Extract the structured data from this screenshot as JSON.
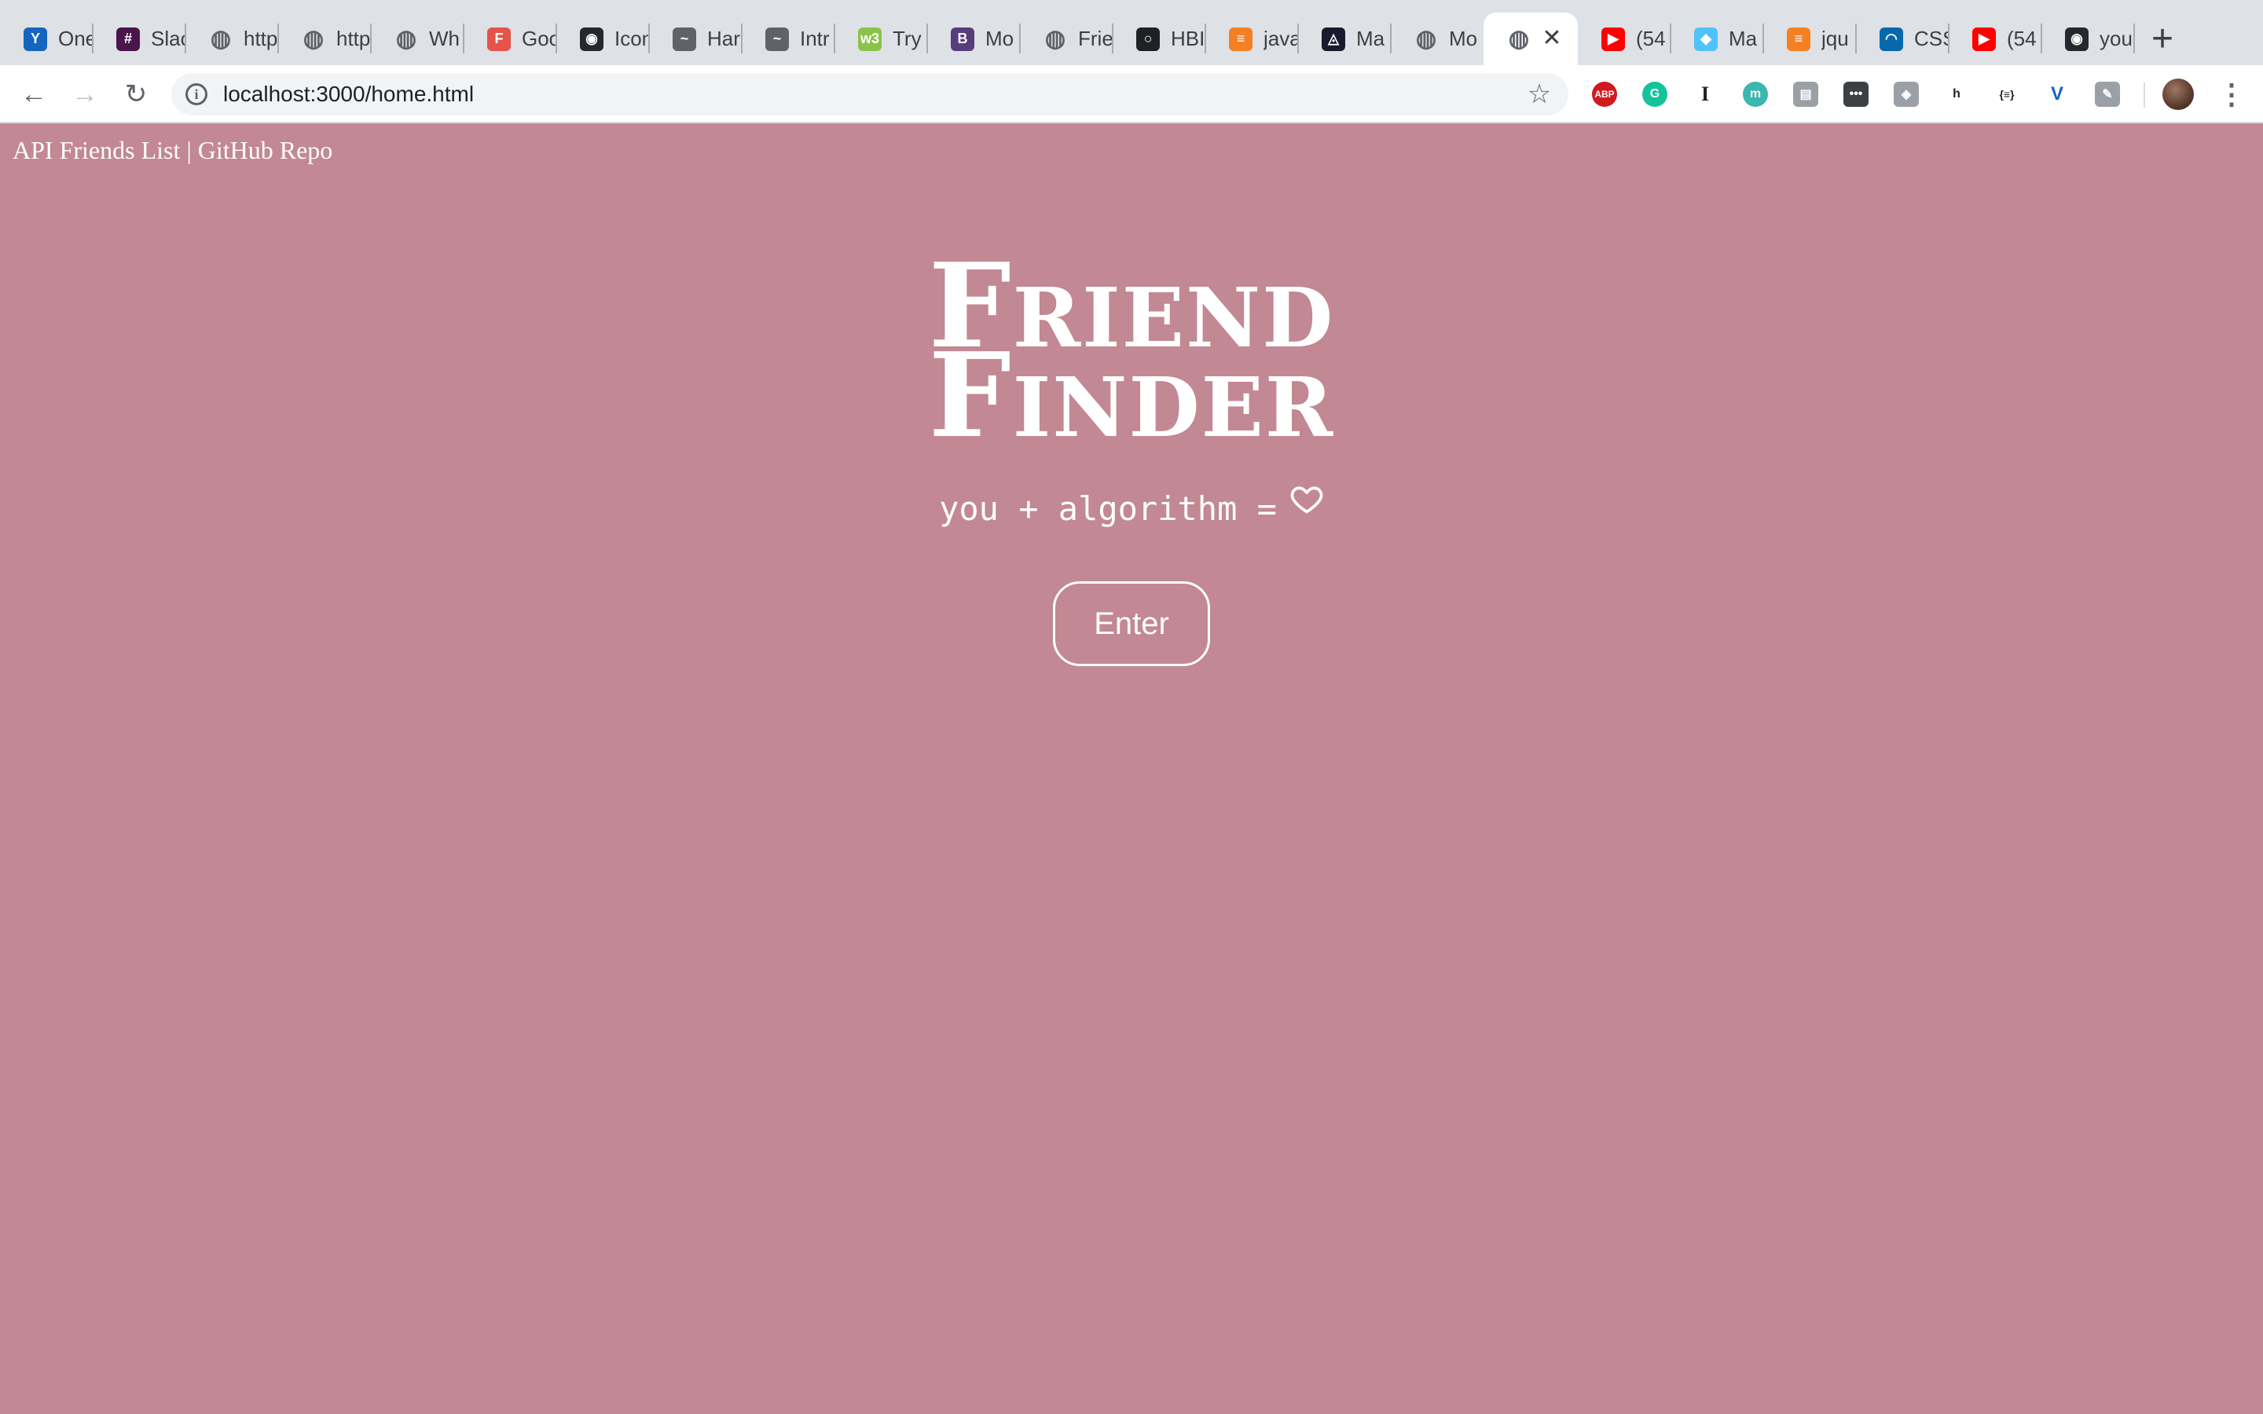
{
  "browser": {
    "tabs": [
      {
        "title": "One",
        "favicon": "vee-icon",
        "color": "#1565c0"
      },
      {
        "title": "Slac",
        "favicon": "slack-icon",
        "color": "#4a154b"
      },
      {
        "title": "http",
        "favicon": "globe-icon",
        "color": "#5f6368"
      },
      {
        "title": "http",
        "favicon": "globe-icon",
        "color": "#5f6368"
      },
      {
        "title": "Wh",
        "favicon": "globe-icon",
        "color": "#5f6368"
      },
      {
        "title": "Goo",
        "favicon": "f-icon",
        "color": "#e5534b"
      },
      {
        "title": "Icon",
        "favicon": "github-octo-icon",
        "color": "#24292e"
      },
      {
        "title": "Har",
        "favicon": "mustache-icon",
        "color": "#5f6368"
      },
      {
        "title": "Intr",
        "favicon": "mustache-icon",
        "color": "#5f6368"
      },
      {
        "title": "Try",
        "favicon": "w3schools-icon",
        "color": "#8bc34a"
      },
      {
        "title": "Mo",
        "favicon": "bootstrap-icon",
        "color": "#563d7c"
      },
      {
        "title": "Frie",
        "favicon": "globe-icon",
        "color": "#5f6368"
      },
      {
        "title": "HBI",
        "favicon": "ring-icon",
        "color": "#202124"
      },
      {
        "title": "java",
        "favicon": "stackoverflow-icon",
        "color": "#f48024"
      },
      {
        "title": "Ma",
        "favicon": "spotlight-icon",
        "color": "#1a1a2e"
      },
      {
        "title": "Mo",
        "favicon": "globe-icon",
        "color": "#5f6368"
      },
      {
        "title": "",
        "favicon": "globe-icon",
        "color": "#5f6368",
        "active": true
      },
      {
        "title": "(54",
        "favicon": "youtube-icon",
        "color": "#ff0000"
      },
      {
        "title": "Ma",
        "favicon": "cap-icon",
        "color": "#4fc3f7"
      },
      {
        "title": "jqu",
        "favicon": "stackoverflow-icon",
        "color": "#f48024"
      },
      {
        "title": "CSS",
        "favicon": "jquery-icon",
        "color": "#0769ad"
      },
      {
        "title": "(54",
        "favicon": "youtube-icon",
        "color": "#ff0000"
      },
      {
        "title": "you",
        "favicon": "github-icon",
        "color": "#24292e"
      }
    ],
    "close_glyph": "✕",
    "new_tab_glyph": "+",
    "back_glyph": "←",
    "forward_glyph": "→",
    "reload_glyph": "↻",
    "info_glyph": "i",
    "star_glyph": "☆",
    "menu_glyph": "⋮",
    "url": "localhost:3000/home.html",
    "extensions": [
      {
        "name": "adblock-plus-icon",
        "label": "ABP",
        "color": "#d4181f"
      },
      {
        "name": "grammarly-icon",
        "label": "G",
        "color": "#15c39a"
      },
      {
        "name": "instapaper-icon",
        "label": "I",
        "color": "#ffffff"
      },
      {
        "name": "mercury-icon",
        "label": "m",
        "color": "#3ab7ae"
      },
      {
        "name": "clipper-icon",
        "label": "▤",
        "color": "#9aa0a6"
      },
      {
        "name": "lastpass-icon",
        "label": "•••",
        "color": "#3c4043"
      },
      {
        "name": "shield-icon",
        "label": "◈",
        "color": "#9aa0a6"
      },
      {
        "name": "hypothesis-icon",
        "label": "h",
        "color": "#bdbdbd"
      },
      {
        "name": "json-viewer-icon",
        "label": "{≡}",
        "color": "#ffffff"
      },
      {
        "name": "vee-ext-icon",
        "label": "V",
        "color": "#ffffff"
      },
      {
        "name": "eyedropper-icon",
        "label": "✎",
        "color": "#9aa0a6"
      }
    ]
  },
  "page": {
    "nav": {
      "api_link": "API Friends List",
      "separator": " | ",
      "repo_link": "GitHub Repo"
    },
    "title_line1": "Friend",
    "title_line2": "Finder",
    "tagline": "you + algorithm =",
    "tagline_icon": "heart-icon",
    "enter_label": "Enter",
    "background_color": "#c28893",
    "text_color": "#ffffff"
  }
}
